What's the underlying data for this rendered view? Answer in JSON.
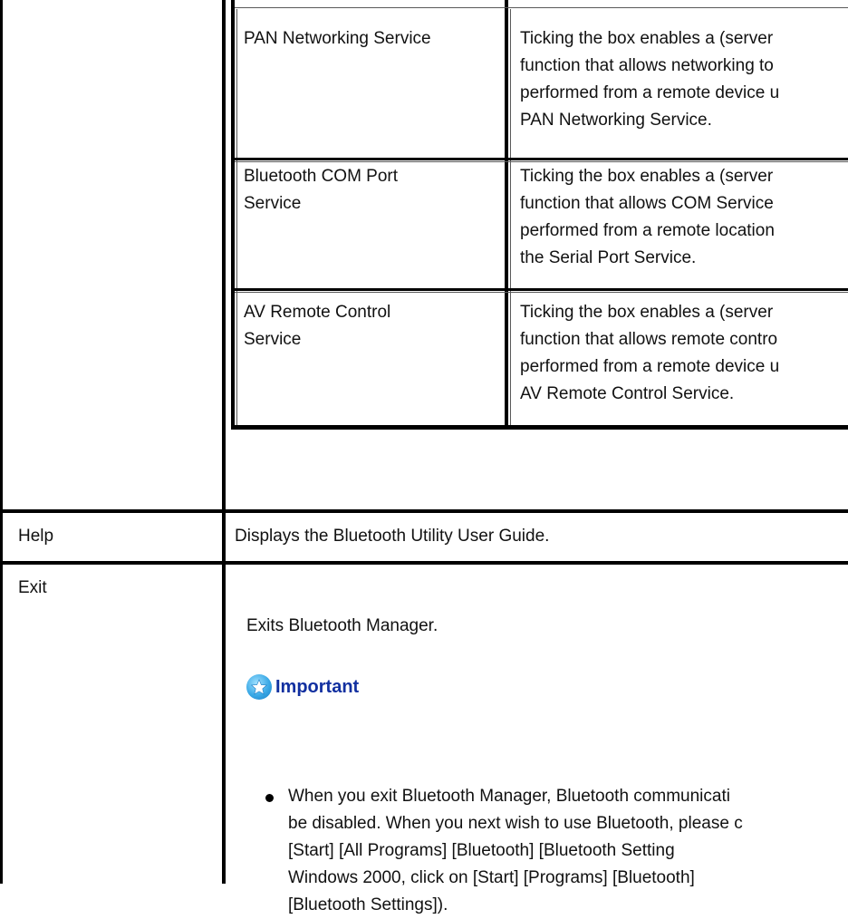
{
  "inner_table": {
    "rows": [
      {
        "service": [
          "PAN Networking Service"
        ],
        "description": [
          "Ticking the box enables a (server",
          "function that allows networking to",
          "performed from a remote device u",
          "PAN Networking Service."
        ]
      },
      {
        "service": [
          "Bluetooth COM Port",
          "Service"
        ],
        "description": [
          "Ticking the box enables a (server",
          "function that allows COM Service",
          "performed from a remote location",
          "the Serial Port Service."
        ]
      },
      {
        "service": [
          "AV Remote Control",
          "Service"
        ],
        "description": [
          "Ticking the box enables a (server",
          "function that allows remote contro",
          "performed from a remote device u",
          "AV Remote Control Service."
        ]
      }
    ]
  },
  "outer_table": {
    "help": {
      "label": "Help",
      "description": "Displays the Bluetooth Utility User Guide."
    },
    "exit": {
      "label": "Exit",
      "description": "Exits Bluetooth Manager.",
      "important_label": "Important",
      "note_lines": [
        "When you exit Bluetooth Manager, Bluetooth communicati",
        "be disabled. When you next wish to use Bluetooth, please c",
        "[Start]    [All Programs]    [Bluetooth]    [Bluetooth Setting",
        "Windows 2000, click on [Start]    [Programs]    [Bluetooth]",
        "[Bluetooth Settings])."
      ]
    }
  },
  "colors": {
    "border": "#000000",
    "important_text": "#1230a0",
    "important_icon": "#3aa9e6"
  },
  "icons": {
    "important": "star-badge-icon",
    "bullet": "bullet-dot-icon"
  }
}
